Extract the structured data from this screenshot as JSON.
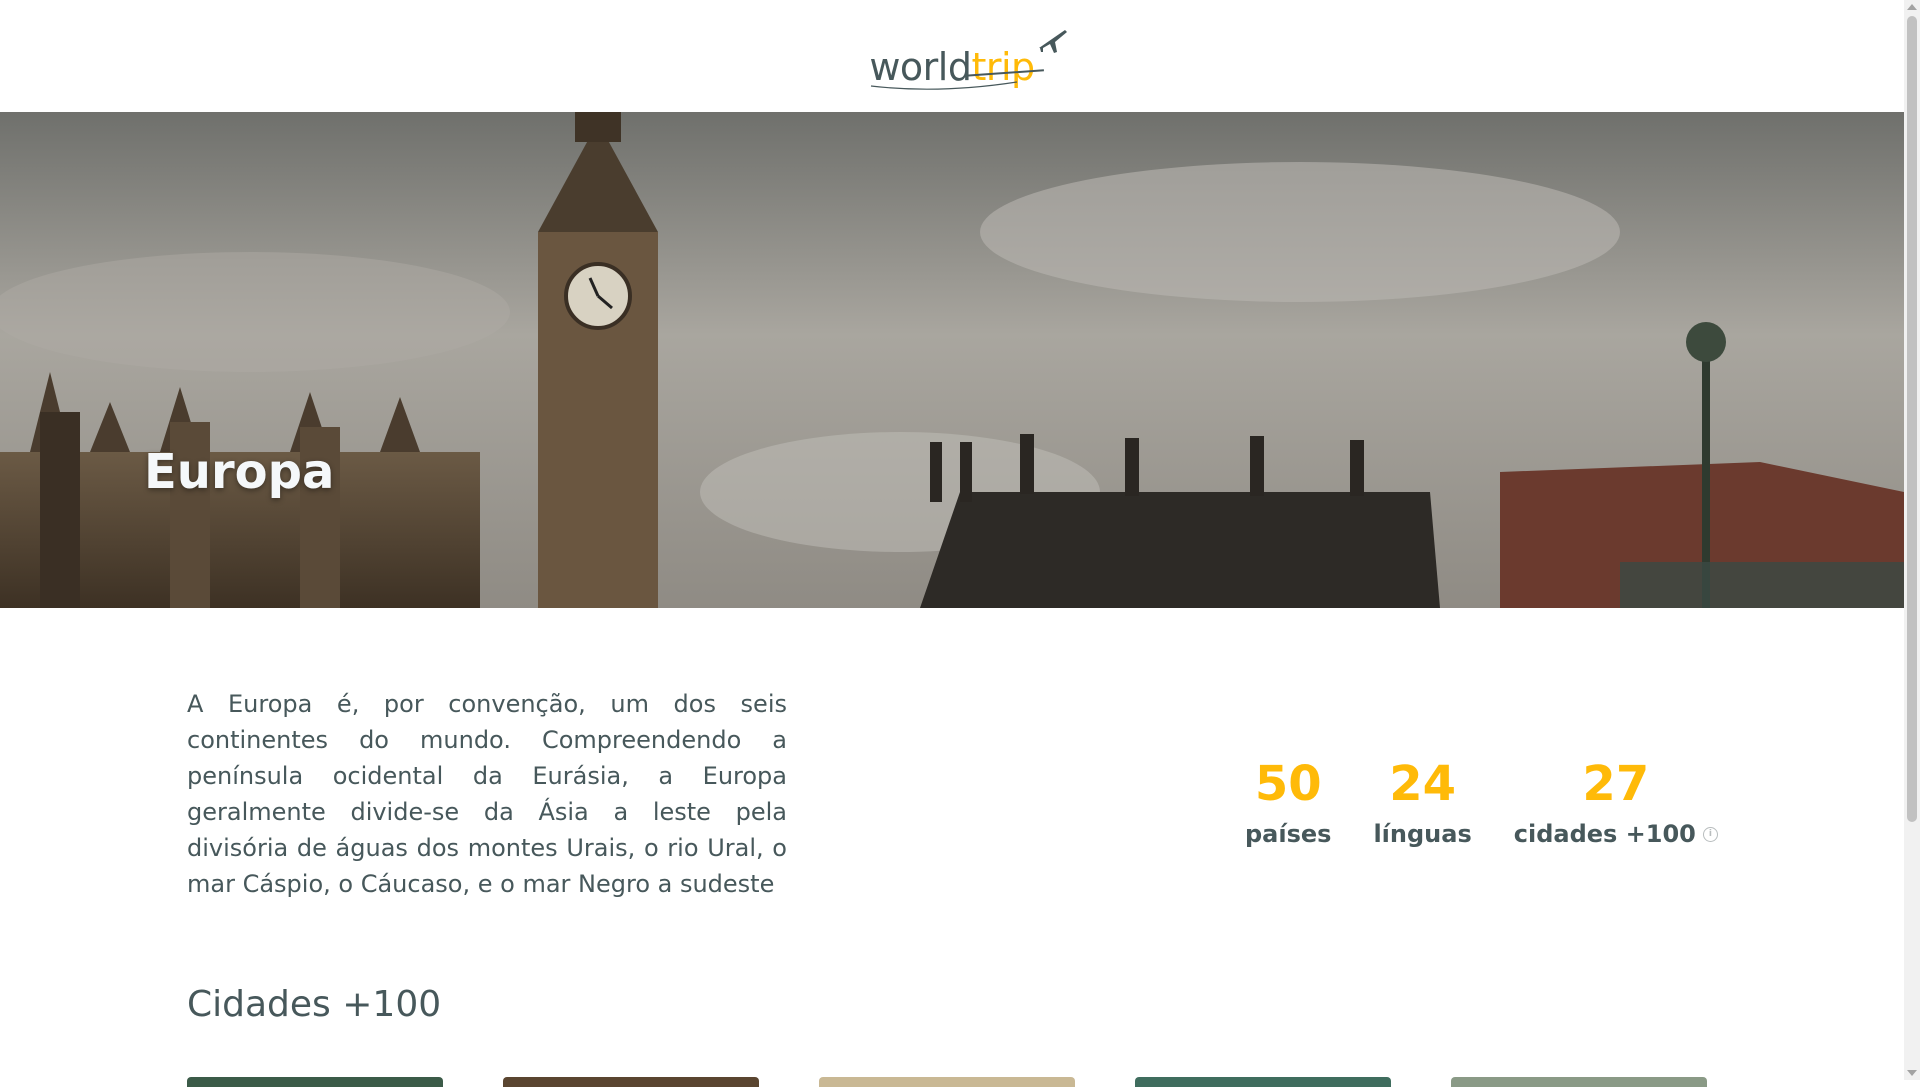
{
  "header": {
    "logo_part1": "world",
    "logo_part2": "trip",
    "logo_plane_icon": "airplane-icon"
  },
  "hero": {
    "title": "Europa"
  },
  "description": "A Europa é, por convenção, um dos seis continentes do mundo. Compreendendo a península ocidental da Eurásia, a Europa geralmente divide-se da Ásia a leste pela divisória de águas dos montes Urais, o rio Ural, o mar Cáspio, o Cáucaso, e o mar Negro a sudeste",
  "stats": [
    {
      "value": "50",
      "label": "países"
    },
    {
      "value": "24",
      "label": "línguas"
    },
    {
      "value": "27",
      "label": "cidades +100",
      "info_icon": "info-icon"
    }
  ],
  "cities_section": {
    "title": "Cidades +100"
  },
  "colors": {
    "highlight": "#FFBA08",
    "text_dark": "#47585B",
    "text_light": "#F5F8FA"
  }
}
